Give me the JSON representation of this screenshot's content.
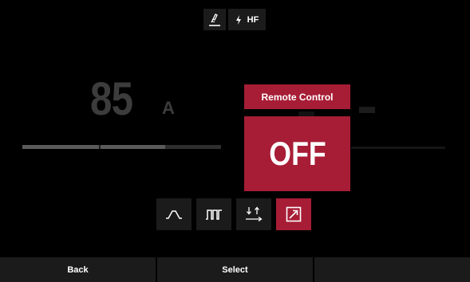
{
  "top_bar": {
    "torch_icon": "torch-weld-icon",
    "hf_icon": "lightning-bolt-icon",
    "hf_label": "HF"
  },
  "current": {
    "value": "85",
    "unit": "A",
    "level": 0.72
  },
  "remote_control": {
    "title": "Remote Control",
    "state": "OFF"
  },
  "modes": [
    {
      "icon": "pulse-curve-icon",
      "active": false
    },
    {
      "icon": "square-wave-icon",
      "active": false
    },
    {
      "icon": "two-stroke-arrows-icon",
      "active": false
    },
    {
      "icon": "remote-arrow-icon",
      "active": true
    }
  ],
  "softkeys": {
    "left": "Back",
    "center": "Select",
    "right": ""
  },
  "colors": {
    "accent": "#a71d36",
    "button_bg": "#1b1b1b",
    "dim_text": "#3c3c3c"
  }
}
